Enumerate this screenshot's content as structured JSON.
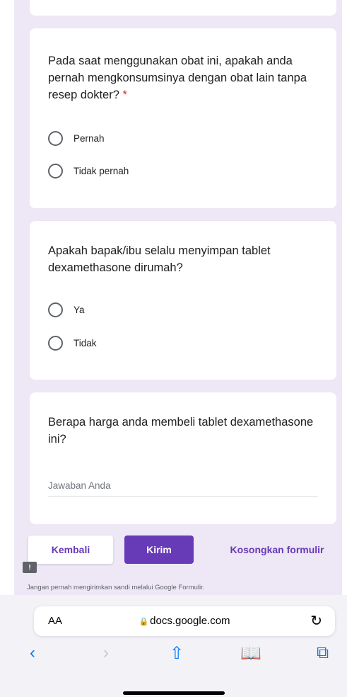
{
  "questions": [
    {
      "text": "Pada saat menggunakan obat ini, apakah anda pernah mengkonsumsinya dengan obat lain tanpa resep dokter?",
      "required_mark": "*",
      "options": [
        "Pernah",
        "Tidak pernah"
      ]
    },
    {
      "text": "Apakah bapak/ibu selalu menyimpan tablet dexamethasone dirumah?",
      "options": [
        "Ya",
        "Tidak"
      ]
    },
    {
      "text": "Berapa harga anda membeli tablet dexamethasone ini?",
      "placeholder": "Jawaban Anda"
    }
  ],
  "footer": {
    "back_label": "Kembali",
    "submit_label": "Kirim",
    "clear_label": "Kosongkan formulir",
    "flag_icon": "!",
    "warning": "Jangan pernah mengirimkan sandi melalui Google Formulir."
  },
  "browser": {
    "text_size_label": "AA",
    "url": "docs.google.com",
    "lock_icon": "lock-icon",
    "reload_icon": "↻"
  },
  "toolbar": {
    "back": "‹",
    "forward": "›",
    "share": "⇧",
    "bookmarks": "📖",
    "tabs": "⧉"
  },
  "colors": {
    "accent": "#673ab7",
    "background": "#ede7f6",
    "required": "#d93025",
    "ios_blue": "#007aff"
  }
}
